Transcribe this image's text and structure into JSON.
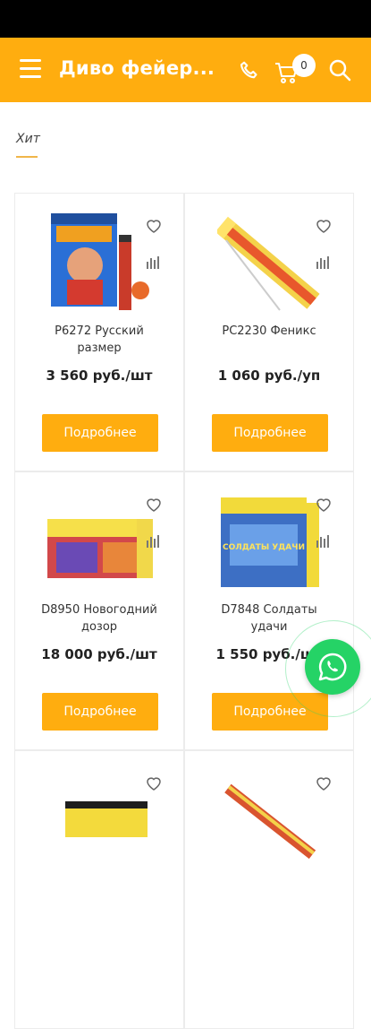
{
  "header": {
    "title": "Диво фейер...",
    "cart_count": "0"
  },
  "tabs": [
    {
      "label": "Хит",
      "active": true
    }
  ],
  "products": [
    {
      "name": "P6272 Русский размер",
      "price": "3 560 руб./шт",
      "button": "Подробнее"
    },
    {
      "name": "PC2230 Феникс",
      "price": "1 060 руб./уп",
      "button": "Подробнее"
    },
    {
      "name": "D8950 Новогодний дозор",
      "price": "18 000 руб./шт",
      "button": "Подробнее"
    },
    {
      "name": "D7848 Солдаты удачи",
      "price": "1 550 руб./шт",
      "button": "Подробнее"
    }
  ],
  "product_image_captions": {
    "p4": "СОЛДАТЫ УДАЧИ"
  },
  "colors": {
    "accent": "#ffad0f",
    "whatsapp": "#25d366"
  },
  "icons": [
    "menu-icon",
    "phone-icon",
    "cart-icon",
    "search-icon",
    "heart-icon",
    "compare-icon",
    "whatsapp-icon"
  ]
}
